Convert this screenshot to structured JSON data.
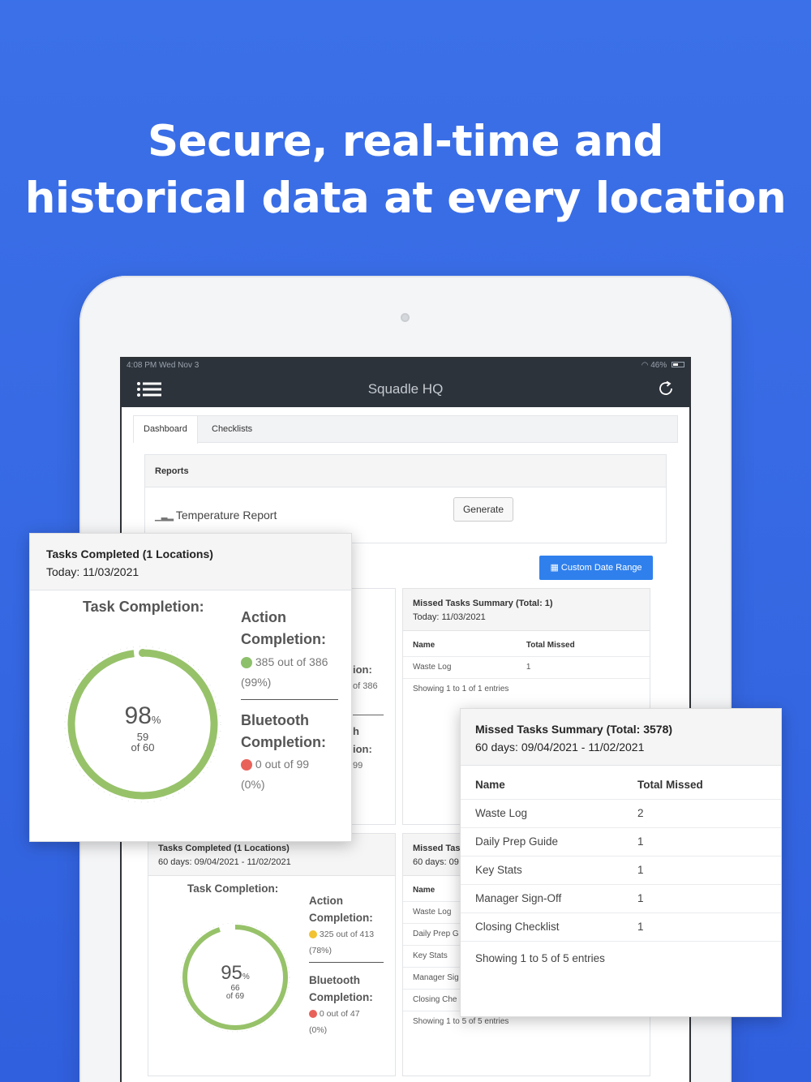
{
  "headline": {
    "line1": "Secure, real-time and",
    "line2": "historical data at every location"
  },
  "statusbar": {
    "time": "4:08 PM  Wed Nov 3",
    "battery": "46%"
  },
  "app": {
    "title": "Squadle HQ"
  },
  "tabs": [
    {
      "label": "Dashboard"
    },
    {
      "label": "Checklists"
    }
  ],
  "reports": {
    "header": "Reports",
    "temperature_report": "Temperature Report",
    "generate_label": "Generate"
  },
  "custom_date_range": "Custom Date Range",
  "overlay_tasks": {
    "title": "Tasks Completed (1 Locations)",
    "subtitle": "Today: 11/03/2021",
    "task_completion_label": "Task Completion:",
    "percent": 98,
    "percent_sign": "%",
    "done": "59",
    "of_total": "of 60",
    "action_label_1": "Action",
    "action_label_2": "Completion:",
    "action_value": "385 out of 386",
    "action_pct": "(99%)",
    "bt_label_1": "Bluetooth",
    "bt_label_2": "Completion:",
    "bt_value": "0 out of 99",
    "bt_pct": "(0%)",
    "colors": {
      "ring": "#97c26a",
      "green": "#8dc06b",
      "red": "#e8625a"
    }
  },
  "bg_panel_peek": {
    "a": "ion:",
    "b": "of 386",
    "c": "h",
    "d": "ion:",
    "e": "99"
  },
  "missed_today": {
    "title": "Missed Tasks Summary (Total: 1)",
    "subtitle": "Today: 11/03/2021",
    "col_name": "Name",
    "col_missed": "Total Missed",
    "rows": [
      {
        "name": "Waste Log",
        "missed": "1"
      }
    ],
    "footer": "Showing 1 to 1 of 1 entries"
  },
  "tasks_60": {
    "title": "Tasks Completed (1 Locations)",
    "subtitle": "60 days: 09/04/2021 - 11/02/2021",
    "task_completion_label": "Task Completion:",
    "percent": 95,
    "percent_sign": "%",
    "done": "66",
    "of_total": "of 69",
    "action_label_1": "Action",
    "action_label_2": "Completion:",
    "action_value": "325 out of 413",
    "action_pct": "(78%)",
    "bt_label_1": "Bluetooth",
    "bt_label_2": "Completion:",
    "bt_value": "0 out of 47",
    "bt_pct": "(0%)",
    "colors": {
      "yellow": "#f1c232",
      "red": "#e8625a"
    }
  },
  "missed_60_bg": {
    "title": "Missed Tas",
    "subtitle": "60 days: 09",
    "col_name": "Name",
    "rows": [
      "Waste Log",
      "Daily Prep G",
      "Key Stats",
      "Manager Sig",
      "Closing Che"
    ],
    "footer": "Showing 1 to 5 of 5 entries"
  },
  "overlay_missed": {
    "title": "Missed Tasks Summary (Total: 3578)",
    "subtitle": "60 days: 09/04/2021 - 11/02/2021",
    "col_name": "Name",
    "col_missed": "Total Missed",
    "rows": [
      {
        "name": "Waste Log",
        "missed": "2"
      },
      {
        "name": "Daily Prep Guide",
        "missed": "1"
      },
      {
        "name": "Key Stats",
        "missed": "1"
      },
      {
        "name": "Manager Sign-Off",
        "missed": "1"
      },
      {
        "name": "Closing Checklist",
        "missed": "1"
      }
    ],
    "footer": "Showing 1 to 5 of 5 entries"
  }
}
